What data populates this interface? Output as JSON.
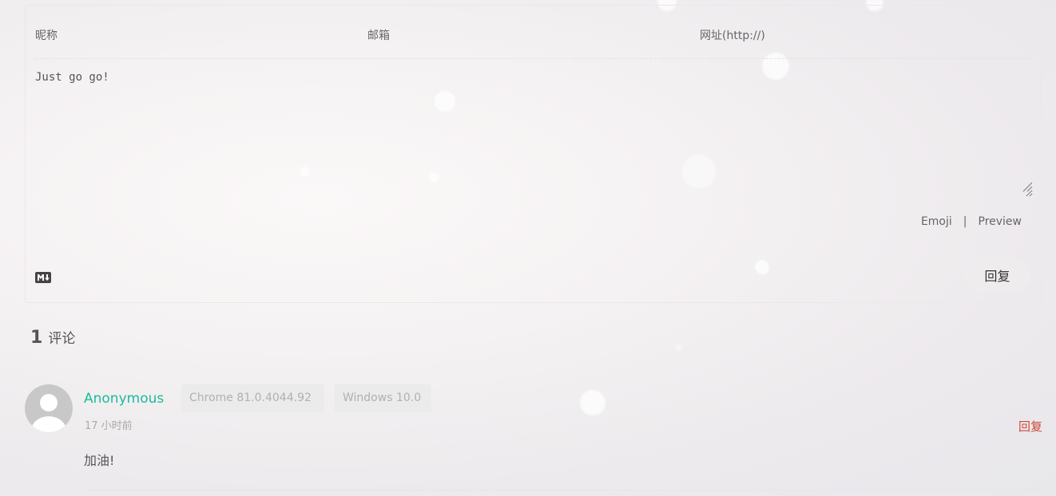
{
  "form": {
    "nick_placeholder": "昵称",
    "mail_placeholder": "邮箱",
    "link_placeholder": "网址(http://)",
    "comment_value": "Just go go!",
    "emoji_label": "Emoji",
    "separator": "|",
    "preview_label": "Preview",
    "submit_label": "回复",
    "markdown_icon": "markdown-icon"
  },
  "comments": {
    "count": "1",
    "count_label": "评论",
    "items": [
      {
        "nick": "Anonymous",
        "browser": "Chrome 81.0.4044.92",
        "os": "Windows 10.0",
        "time": "17 小时前",
        "reply_label": "回复",
        "content": "加油!"
      }
    ]
  },
  "colors": {
    "nick": "#1abc9c",
    "reply": "#d0463a"
  }
}
